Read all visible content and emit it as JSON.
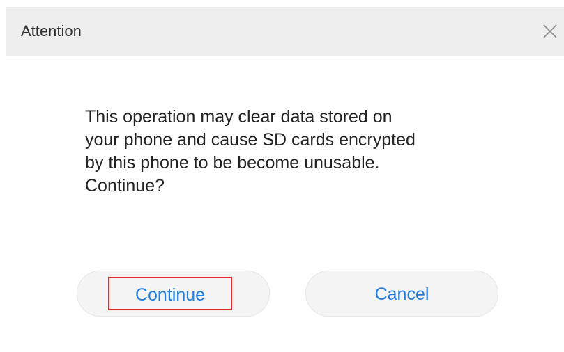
{
  "dialog": {
    "title": "Attention",
    "close_icon": "close-icon",
    "message_lines": [
      "This operation may clear data stored on",
      "your phone and cause SD cards encrypted",
      "by this phone to be become unusable.",
      "Continue?"
    ],
    "continue_label": "Continue",
    "cancel_label": "Cancel"
  },
  "colors": {
    "accent": "#1f7de0",
    "highlight_border": "#e52a2a",
    "titlebar_bg": "#eeeeee",
    "button_bg": "#f4f4f4"
  }
}
